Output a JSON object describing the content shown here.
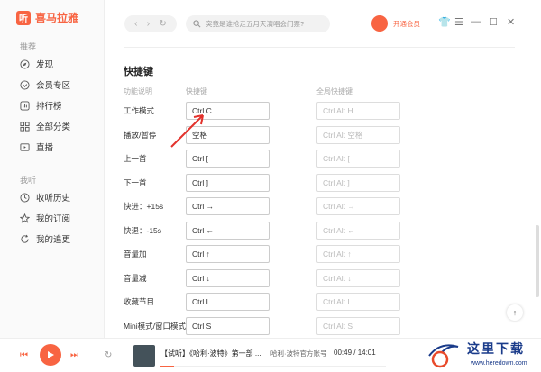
{
  "app": {
    "name": "喜马拉雅",
    "logo_mark": "听"
  },
  "sidebar": {
    "section1": "推荐",
    "items1": [
      {
        "label": "发现",
        "icon": "compass-icon"
      },
      {
        "label": "会员专区",
        "icon": "vip-icon"
      },
      {
        "label": "排行榜",
        "icon": "ranking-icon"
      },
      {
        "label": "全部分类",
        "icon": "category-icon"
      },
      {
        "label": "直播",
        "icon": "live-icon"
      }
    ],
    "section2": "我听",
    "items2": [
      {
        "label": "收听历史",
        "icon": "clock-icon"
      },
      {
        "label": "我的订阅",
        "icon": "star-icon"
      },
      {
        "label": "我的追更",
        "icon": "refresh-icon"
      }
    ]
  },
  "topbar": {
    "search_placeholder": "突竟是谁抢走五月天演唱会门票?",
    "vip_label": "开通会员"
  },
  "page": {
    "title": "快捷键",
    "col_function": "功能说明",
    "col_hotkey": "快捷键",
    "col_global": "全局快捷键",
    "rows": [
      {
        "label": "工作模式",
        "key": "Ctrl C",
        "global": "Ctrl Alt H"
      },
      {
        "label": "播放/暂停",
        "key": "空格",
        "global": "Ctrl Alt 空格"
      },
      {
        "label": "上一首",
        "key": "Ctrl [",
        "global": "Ctrl Alt ["
      },
      {
        "label": "下一首",
        "key": "Ctrl ]",
        "global": "Ctrl Alt ]"
      },
      {
        "label": "快进：+15s",
        "key": "Ctrl →",
        "global": "Ctrl Alt →"
      },
      {
        "label": "快退：-15s",
        "key": "Ctrl ←",
        "global": "Ctrl Alt ←"
      },
      {
        "label": "音量加",
        "key": "Ctrl ↑",
        "global": "Ctrl Alt ↑"
      },
      {
        "label": "音量减",
        "key": "Ctrl ↓",
        "global": "Ctrl Alt ↓"
      },
      {
        "label": "收藏节目",
        "key": "Ctrl L",
        "global": "Ctrl Alt L"
      },
      {
        "label": "Mini模式/窗口模式",
        "key": "Ctrl S",
        "global": "Ctrl Alt S"
      }
    ]
  },
  "player": {
    "track_title": "【试听】《哈利·波特》第一部 ...",
    "track_author": "哈利·波特官方账号",
    "time": "00:49 / 14:01",
    "progress": 0.06
  },
  "watermark": {
    "text": "这里下载",
    "url": "www.heredown.com"
  },
  "colors": {
    "accent": "#f86442"
  }
}
